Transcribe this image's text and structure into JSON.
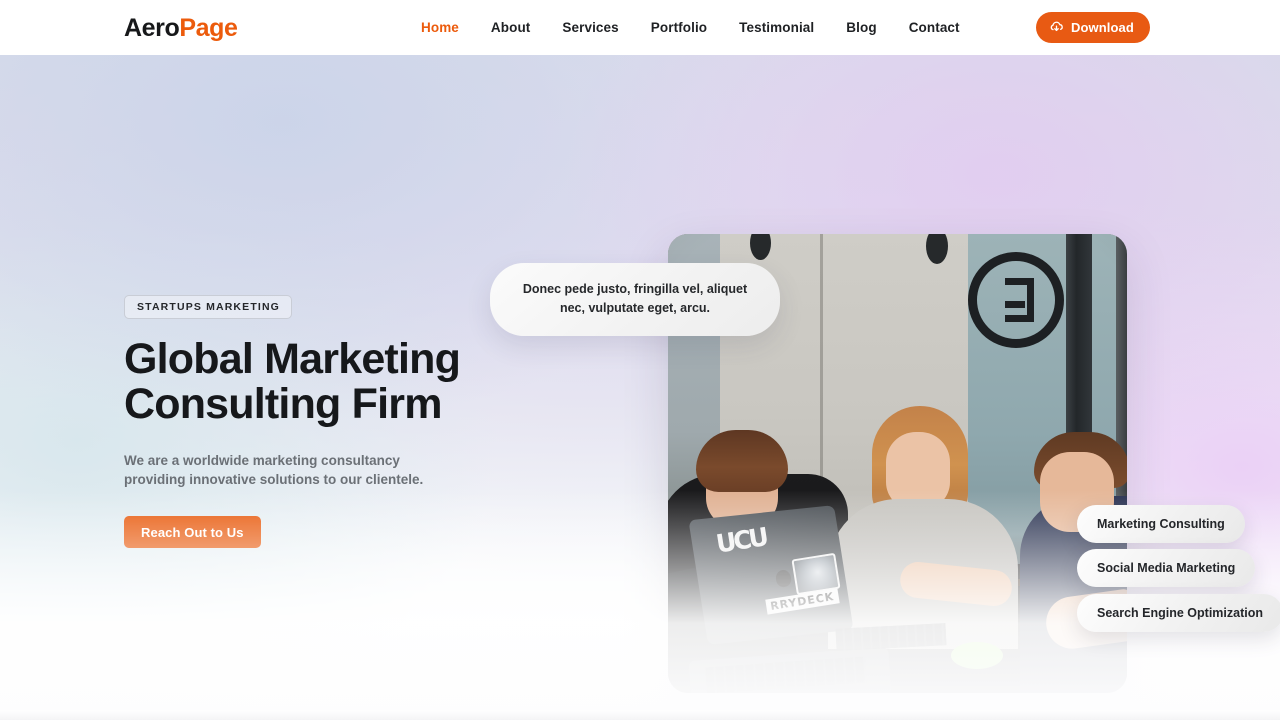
{
  "header": {
    "logo": {
      "part1": "Aero",
      "part2": "Page"
    },
    "nav": [
      {
        "label": "Home",
        "active": true
      },
      {
        "label": "About",
        "active": false
      },
      {
        "label": "Services",
        "active": false
      },
      {
        "label": "Portfolio",
        "active": false
      },
      {
        "label": "Testimonial",
        "active": false
      },
      {
        "label": "Blog",
        "active": false
      },
      {
        "label": "Contact",
        "active": false
      }
    ],
    "download_button": {
      "label": "Download",
      "icon": "cloud-download-icon"
    },
    "accent_color": "#ec5b0c"
  },
  "hero": {
    "eyebrow": "STARTUPS MARKETING",
    "title_line1": "Global Marketing",
    "title_line2": "Consulting Firm",
    "subtitle": "We are a worldwide marketing consultancy providing innovative solutions to our clientele.",
    "cta_label": "Reach Out to Us",
    "cta_color": "#e8590c",
    "quote_bubble": "Donec pede justo, fringilla vel, aliquet nec, vulputate eget, arcu.",
    "service_pills": [
      {
        "label": "Marketing Consulting"
      },
      {
        "label": "Social Media Marketing"
      },
      {
        "label": "Search Engine Optimization"
      }
    ],
    "photo_alt": "three colleagues working around a laptop in an office",
    "accent_green": "#8ee84a"
  }
}
